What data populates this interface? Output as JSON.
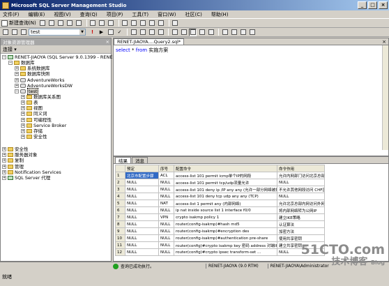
{
  "window": {
    "title": "Microsoft SQL Server Management Studio"
  },
  "menu": [
    "文件(F)",
    "编辑(E)",
    "视图(V)",
    "查询(Q)",
    "项目(P)",
    "工具(T)",
    "窗口(W)",
    "社区(C)",
    "帮助(H)"
  ],
  "toolbar": {
    "new_query": "新建查询(N)",
    "database": "test",
    "execute_label": "执行(X)"
  },
  "object_explorer": {
    "title": "对象资源管理器",
    "connect_label": "连接 ▾",
    "nodes": [
      "RENET-JIAOYA (SQL Server 9.0.1399 - RENE",
      "数据库",
      "系统数据库",
      "数据库快照",
      "AdventureWorks",
      "AdventureWorksDW",
      "test",
      "数据库关系图",
      "表",
      "视图",
      "同义词",
      "可编程性",
      "Service Broker",
      "存储",
      "安全性",
      "安全性",
      "服务器对象",
      "复制",
      "管理",
      "Notification Services",
      "SQL Server 代理"
    ]
  },
  "editor": {
    "tab_label": "RENET-JIAOYA....Query2.sql*",
    "sql": {
      "kw1": "select",
      "mid": " * ",
      "kw2": "from",
      "rest": " 实施方案"
    }
  },
  "results": {
    "tabs": [
      "结果",
      "消息"
    ],
    "columns": [
      "",
      "预定",
      "序号",
      "配置命令",
      "命令作用"
    ],
    "rows": [
      [
        "1",
        "北京市配置步骤",
        "ACL",
        "access-list 101 permit icmp单个IP的网段",
        "允许内网部门访问北京总部"
      ],
      [
        "2",
        "NULL",
        "NULL",
        "access-list 101 permit tcp/udp流量允许",
        "NULL"
      ],
      [
        "3",
        "NULL",
        "NULL",
        "access-list 101 deny ip /IP any any (允许一部分网络被拒绝)",
        "不允许其他网段访问 CHF区间"
      ],
      [
        "4",
        "NULL",
        "NULL",
        "access-list 101 deny tcp udp any any (TCP)",
        "NULL"
      ],
      [
        "5",
        "NULL",
        "NAT",
        "access-list 1 permit any (内部网络)",
        "允许北京总部内网访问外网"
      ],
      [
        "6",
        "NULL",
        "NULL",
        "ip nat inside source list 1 interface f0/0",
        "将内部网络转为公网IP"
      ],
      [
        "7",
        "NULL",
        "VPN",
        "crypto isakmp policy 1",
        "建立IKE策略"
      ],
      [
        "8",
        "NULL",
        "NULL",
        "router(config-isakmp)#hash md5",
        "认证算法"
      ],
      [
        "9",
        "NULL",
        "NULL",
        "router(config-isakmp)#encryption des",
        "加密方法"
      ],
      [
        "10",
        "NULL",
        "NULL",
        "router(config-isakmp)#authentication pre-share",
        "使用共享密钥"
      ],
      [
        "11",
        "NULL",
        "NULL",
        "router(config)#crypto isakmp key 密码 address 对端IP(对端地址)",
        "建立共享密钥 ..."
      ],
      [
        "12",
        "NULL",
        "NULL",
        "router(config)#crypto ipsec transform-set ...",
        "NULL"
      ]
    ]
  },
  "status": {
    "ok_message": "查询已成功执行。",
    "server": "RENET-JIAOYA (9.0 RTM)",
    "user": "RENET-JIAOYA\\Administrator",
    "ready": "就绪"
  },
  "watermark": {
    "logo": "51CTO.com",
    "sub": "技术博客",
    "blog": "Blog"
  }
}
